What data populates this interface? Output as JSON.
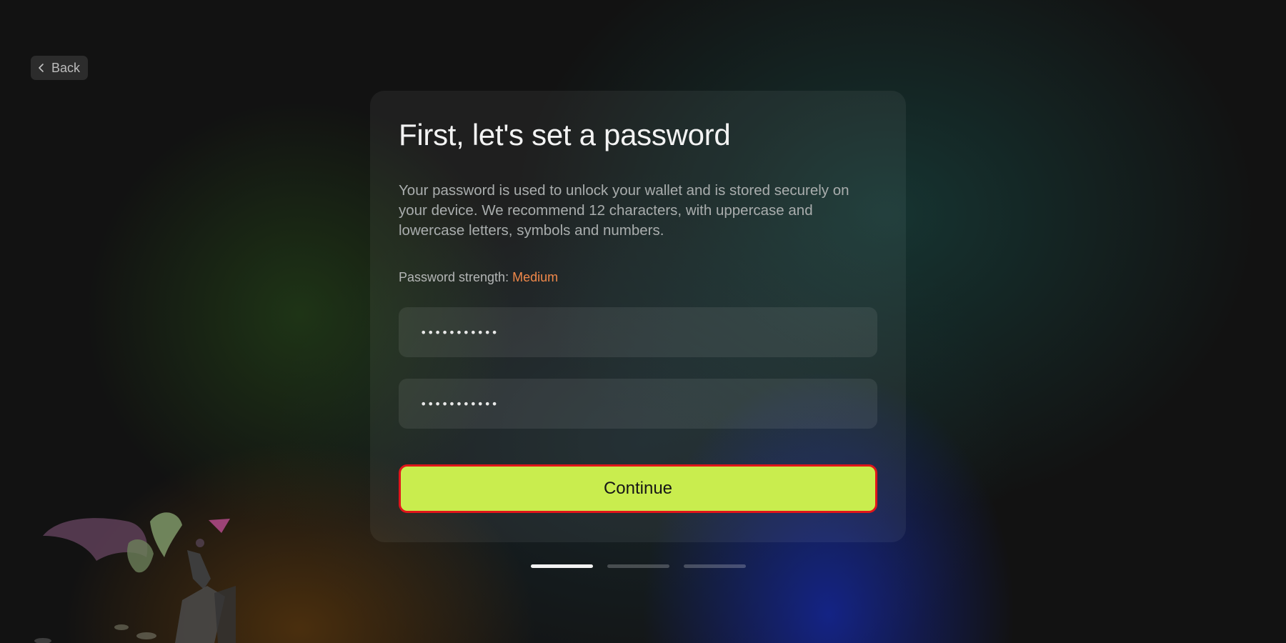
{
  "back_button": {
    "label": "Back"
  },
  "card": {
    "title": "First, let's set a password",
    "description": "Your password is used to unlock your wallet and is stored securely on your device. We recommend 12 characters, with uppercase and lowercase letters, symbols and numbers.",
    "strength_label": "Password strength:",
    "strength_value": "Medium",
    "password_field": {
      "value": "•••••••••••"
    },
    "confirm_field": {
      "value": "•••••••••••"
    },
    "continue_label": "Continue"
  },
  "progress": {
    "steps": 3,
    "current": 1
  },
  "colors": {
    "accent": "#c9ed4e",
    "strength_medium": "#f0884a",
    "focus_ring": "#e0161a",
    "background": "#121212"
  }
}
